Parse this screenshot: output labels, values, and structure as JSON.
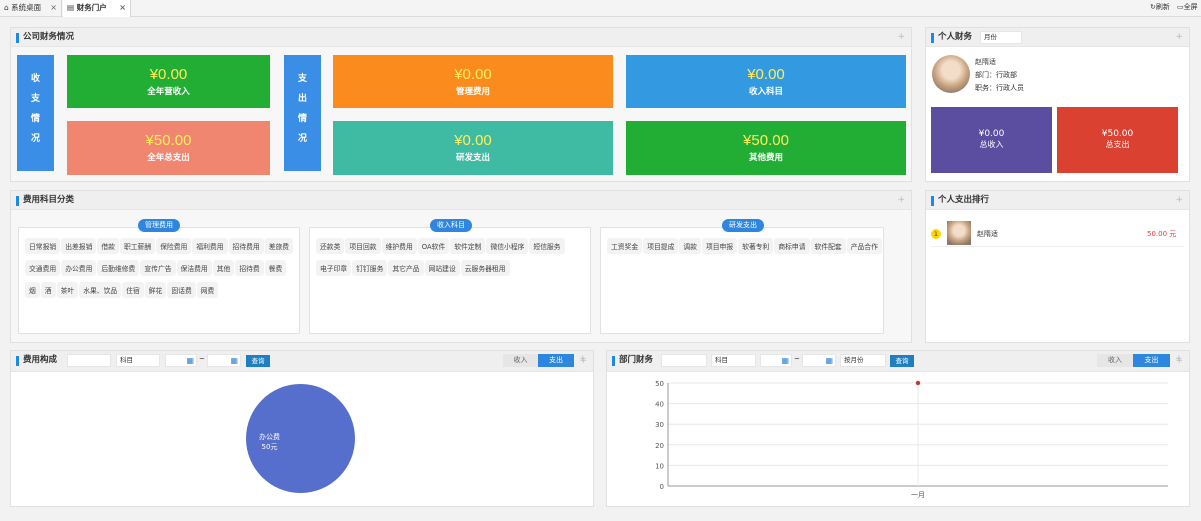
{
  "tabs": [
    {
      "label": "系统桌面",
      "closable": true
    },
    {
      "label": "财务门户",
      "closable": true
    }
  ],
  "toolbar": {
    "refresh": "刷新",
    "fullscreen": "全屏"
  },
  "company": {
    "title": "公司财务情况",
    "income_label": [
      "收",
      "支",
      "情",
      "况"
    ],
    "expense_label": [
      "支",
      "出",
      "情",
      "况"
    ],
    "cards": [
      {
        "value": "¥0.00",
        "label": "全年营收入"
      },
      {
        "value": "¥50.00",
        "label": "全年总支出"
      },
      {
        "value": "¥0.00",
        "label": "管理费用"
      },
      {
        "value": "¥0.00",
        "label": "研发支出"
      },
      {
        "value": "¥0.00",
        "label": "收入科目"
      },
      {
        "value": "¥50.00",
        "label": "其他费用"
      }
    ]
  },
  "personal": {
    "title": "个人财务",
    "period": "月份",
    "name": "赵隋适",
    "dept": "部门：行政部",
    "post": "职务：行政人员",
    "income_value": "¥0.00",
    "income_label": "总收入",
    "expense_value": "¥50.00",
    "expense_label": "总支出"
  },
  "categories": {
    "title": "费用科目分类",
    "groups": [
      {
        "name": "管理费用",
        "items": [
          "日常报销",
          "出差报销",
          "借款",
          "职工薪酬",
          "保险费用",
          "福利费用",
          "招待费用",
          "差旅费",
          "交通费用",
          "办公费用",
          "后勤维修费",
          "宣传广告",
          "保洁费用",
          "其他",
          "招待费",
          "餐费",
          "烟",
          "酒",
          "茶叶",
          "水果、饮品",
          "住宿",
          "鲜花",
          "固话费",
          "网费"
        ]
      },
      {
        "name": "收入科目",
        "items": [
          "还款类",
          "项目回款",
          "维护费用",
          "OA软件",
          "软件定制",
          "微信小程序",
          "短信服务",
          "电子印章",
          "钉钉服务",
          "其它产品",
          "网站建设",
          "云服务器租用"
        ]
      },
      {
        "name": "研发支出",
        "items": [
          "工资奖金",
          "项目提成",
          "调款",
          "项目申报",
          "软著专利",
          "商标申请",
          "软件配套",
          "产品合作"
        ]
      }
    ]
  },
  "ranking": {
    "title": "个人支出排行",
    "rank": "1",
    "name": "赵隋适",
    "amount": "50.00 元"
  },
  "cost": {
    "title": "费用构成",
    "subject_placeholder": "科目",
    "query": "查询",
    "tab_income": "收入",
    "tab_expense": "支出",
    "tilde": "~",
    "pie_label": "办公费",
    "pie_value": "50元"
  },
  "dept": {
    "title": "部门财务",
    "subject_placeholder": "科目",
    "period": "按月份",
    "query": "查询",
    "tab_income": "收入",
    "tab_expense": "支出",
    "tilde": "~"
  },
  "chart_data": {
    "type": "line",
    "categories": [
      "一月"
    ],
    "series": [
      {
        "values": [
          50
        ]
      }
    ],
    "ylim": [
      0,
      50
    ],
    "yticks": [
      "50",
      "40",
      "30",
      "20",
      "10",
      "0"
    ],
    "grid": true
  },
  "colors": {
    "accent": "#1e88e5",
    "green": "#22ae35",
    "orange": "#fc8b1d",
    "blue": "#3399e0",
    "salmon": "#f08670",
    "teal": "#3fbaa3",
    "purple": "#5b4da0",
    "red": "#db4130",
    "pie": "#566ecc"
  }
}
